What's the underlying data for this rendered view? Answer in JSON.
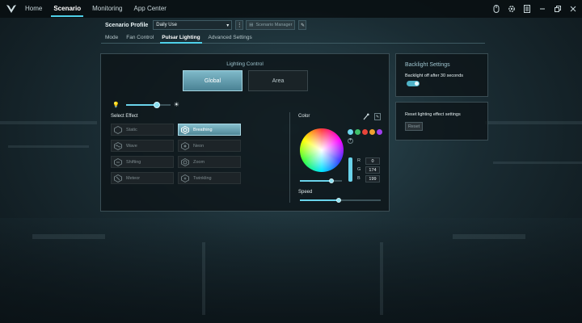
{
  "nav": {
    "items": [
      "Home",
      "Scenario",
      "Monitoring",
      "App Center"
    ],
    "active_index": 1
  },
  "profile": {
    "label": "Scenario Profile",
    "selected": "Daily Use",
    "manager_label": "Scenario Manager"
  },
  "subtabs": {
    "items": [
      "Mode",
      "Fan Control",
      "Pulsar Lighting",
      "Advanced Settings"
    ],
    "active_index": 2
  },
  "lighting": {
    "title": "Lighting Control",
    "global_label": "Global",
    "area_label": "Area",
    "brightness_level": 0.7,
    "select_effect_label": "Select Effect",
    "effects": [
      "Static",
      "Breathing",
      "Wave",
      "Neon",
      "Shifting",
      "Zoom",
      "Meteor",
      "Twinkling"
    ],
    "active_effect": "Breathing"
  },
  "color": {
    "label": "Color",
    "swatches": [
      "#6fd8f0",
      "#3fbf6a",
      "#e8443a",
      "#f0a030",
      "#a23ef0"
    ],
    "rgb": [
      {
        "key": "R",
        "value": "0"
      },
      {
        "key": "G",
        "value": "174"
      },
      {
        "key": "B",
        "value": "199"
      }
    ],
    "hue_level": 0.75,
    "speed_label": "Speed",
    "speed_level": 0.48
  },
  "backlight": {
    "title": "Backlight Settings",
    "text": "Backlight off after 30 seconds",
    "enabled": true
  },
  "reset": {
    "text": "Reset lighting effect settings",
    "button_label": "Reset"
  },
  "accent": "#4fd0e8"
}
